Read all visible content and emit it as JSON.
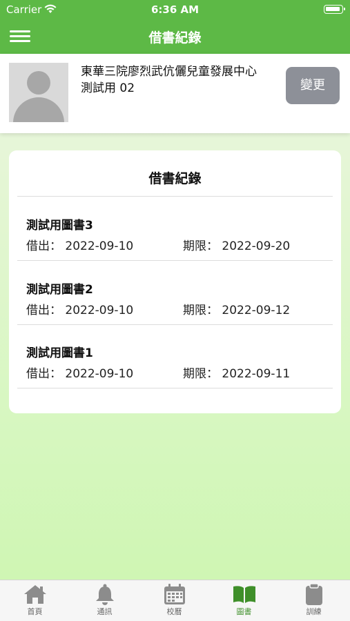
{
  "status": {
    "carrier": "Carrier",
    "time": "6:36 AM"
  },
  "nav": {
    "title": "借書紀錄"
  },
  "profile": {
    "school": "東華三院廖烈武伉儷兒童發展中心",
    "student": "測試用 02",
    "change_label": "變更"
  },
  "card": {
    "title": "借書紀錄",
    "records": [
      {
        "name": "測試用圖書3",
        "borrow": "借出：  2022-09-10",
        "due": "期限：  2022-09-20"
      },
      {
        "name": "測試用圖書2",
        "borrow": "借出：  2022-09-10",
        "due": "期限：  2022-09-12"
      },
      {
        "name": "測試用圖書1",
        "borrow": "借出：  2022-09-10",
        "due": "期限：  2022-09-11"
      }
    ]
  },
  "tabs": [
    {
      "label": "首頁",
      "icon": "home-icon"
    },
    {
      "label": "通訊",
      "icon": "bell-icon"
    },
    {
      "label": "校曆",
      "icon": "calendar-icon"
    },
    {
      "label": "圖書",
      "icon": "book-icon"
    },
    {
      "label": "訓練",
      "icon": "clipboard-icon"
    }
  ],
  "colors": {
    "primary": "#5db946",
    "active_tab": "#3f8f2a",
    "inactive_tab": "#8c8c8c",
    "button_grey": "#8d9098"
  }
}
